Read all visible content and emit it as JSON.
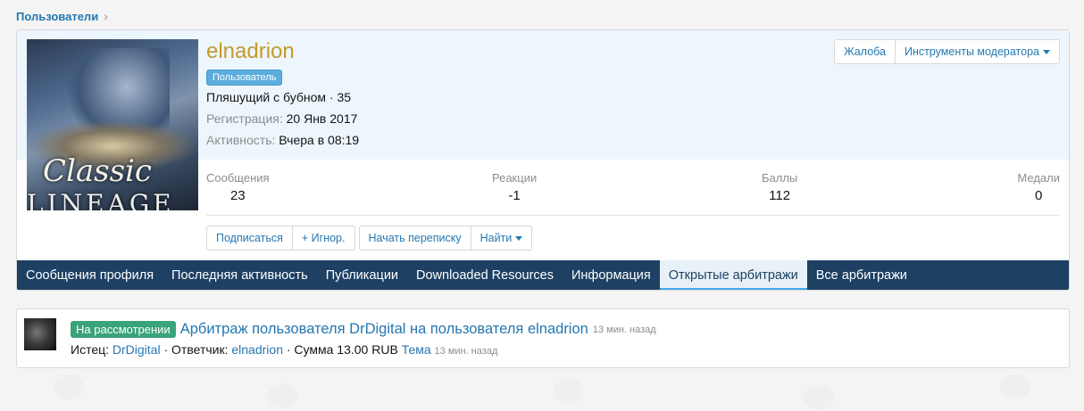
{
  "breadcrumb": {
    "label": "Пользователи",
    "separator": "›"
  },
  "profile": {
    "username": "elnadrion",
    "role": "Пользователь",
    "title_line": "Пляшущий с бубном · 35",
    "registration_label": "Регистрация:",
    "registration_value": "20 Янв 2017",
    "activity_label": "Активность:",
    "activity_value": "Вчера в 08:19",
    "avatar_text_1": "Classic",
    "avatar_text_2": "LINEAGE"
  },
  "top_buttons": {
    "report": "Жалоба",
    "mod_tools": "Инструменты модератора"
  },
  "stats": [
    {
      "label": "Сообщения",
      "value": "23"
    },
    {
      "label": "Реакции",
      "value": "-1"
    },
    {
      "label": "Баллы",
      "value": "112"
    },
    {
      "label": "Медали",
      "value": "0"
    }
  ],
  "actions": {
    "follow": "Подписаться",
    "ignore": "+ Игнор.",
    "start_conversation": "Начать переписку",
    "find": "Найти"
  },
  "tabs": [
    {
      "label": "Сообщения профиля",
      "active": false
    },
    {
      "label": "Последняя активность",
      "active": false
    },
    {
      "label": "Публикации",
      "active": false
    },
    {
      "label": "Downloaded Resources",
      "active": false
    },
    {
      "label": "Информация",
      "active": false
    },
    {
      "label": "Открытые арбитражи",
      "active": true
    },
    {
      "label": "Все арбитражи",
      "active": false
    }
  ],
  "arbitration": {
    "status": "На рассмотрении",
    "title": "Арбитраж пользователя DrDigital на пользователя elnadrion",
    "time": "13 мин. назад",
    "plaintiff_label": "Истец:",
    "plaintiff": "DrDigital",
    "respondent_label": "· Ответчик:",
    "respondent": "elnadrion",
    "amount": "· Сумма 13.00 RUB",
    "thread_label": "Тема",
    "thread_time": "13 мин. назад"
  },
  "colors": {
    "nav_bg": "#1d4063",
    "link": "#2577b1",
    "username": "#c49a2a",
    "status_green": "#39a37a",
    "role_blue": "#5aaddc"
  }
}
